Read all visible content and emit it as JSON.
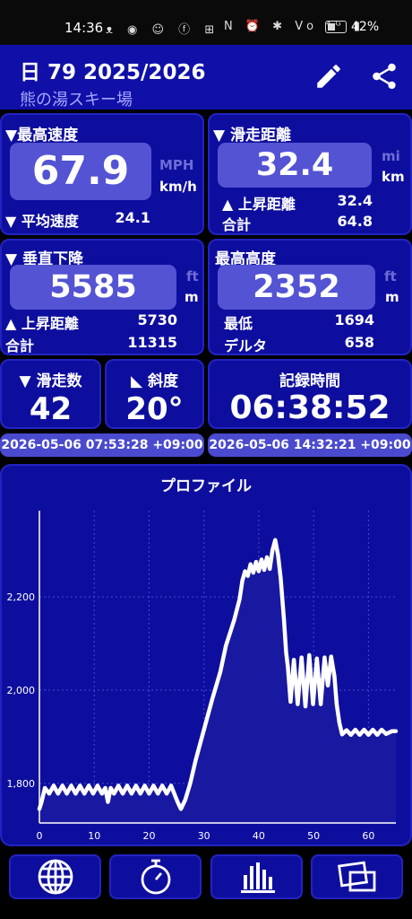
{
  "status_bar": {
    "time": "14:36",
    "left_icons": "ᴥ ◉ ☺ ⓕ ⊞",
    "right_icons": "N ⏰ ✱ Vo ⁴ᴳ ▮",
    "battery": "42%"
  },
  "header": {
    "title": "日 79 2025/2026",
    "subtitle": "熊の湯スキー場"
  },
  "max_speed": {
    "label": "▼最高速度",
    "value": "67.9",
    "unit_inactive": "MPH",
    "unit_active": "km/h",
    "avg_label": "▼ 平均速度",
    "avg_value": "24.1"
  },
  "run_distance": {
    "label": "▼ 滑走距離",
    "value": "32.4",
    "unit_inactive": "mi",
    "unit_active": "km",
    "up_label": "▲ 上昇距離",
    "up_value": "32.4",
    "total_label": "合計",
    "total_value": "64.8"
  },
  "vertical_descent": {
    "label": "▼ 垂直下降",
    "value": "5585",
    "unit_inactive": "ft",
    "unit_active": "m",
    "up_label": "▲ 上昇距離",
    "up_value": "5730",
    "total_label": "合計",
    "total_value": "11315"
  },
  "max_altitude": {
    "label": "最高高度",
    "value": "2352",
    "unit_inactive": "ft",
    "unit_active": "m",
    "min_label": "最低",
    "min_value": "1694",
    "delta_label": "デルタ",
    "delta_value": "658"
  },
  "runs": {
    "label": "▼ 滑走数",
    "value": "42"
  },
  "slope": {
    "label": "◣ 斜度",
    "value": "20°"
  },
  "recording": {
    "label": "記録時間",
    "value": "06:38:52"
  },
  "start_time": "2026-05-06 07:53:28 +09:00",
  "end_time": "2026-05-06 14:32:21 +09:00",
  "nav": [
    "globe-icon",
    "stopwatch-icon",
    "bar-chart-icon",
    "photos-icon"
  ],
  "chart_data": {
    "type": "area",
    "title": "プロファイル",
    "xlabel": "",
    "ylabel": "",
    "xlim": [
      0,
      65
    ],
    "ylim": [
      1715,
      2385
    ],
    "x_ticks": [
      0,
      10,
      20,
      30,
      40,
      50,
      60
    ],
    "y_ticks": [
      1800,
      2000,
      2200
    ],
    "y_tick_labels": [
      "1,800",
      "2,000",
      "2,200"
    ],
    "grid": true,
    "line_color": "#ffffff",
    "fill_color": "#1818a0",
    "points": [
      [
        0,
        1745
      ],
      [
        0.4,
        1760
      ],
      [
        1,
        1790
      ],
      [
        1.8,
        1778
      ],
      [
        2.6,
        1795
      ],
      [
        3.4,
        1778
      ],
      [
        4.2,
        1795
      ],
      [
        5,
        1778
      ],
      [
        5.8,
        1795
      ],
      [
        6.6,
        1778
      ],
      [
        7.4,
        1795
      ],
      [
        8.2,
        1778
      ],
      [
        9,
        1795
      ],
      [
        9.8,
        1778
      ],
      [
        10.6,
        1795
      ],
      [
        11.4,
        1778
      ],
      [
        12,
        1790
      ],
      [
        12.5,
        1760
      ],
      [
        13,
        1790
      ],
      [
        13.6,
        1778
      ],
      [
        14.4,
        1795
      ],
      [
        15.2,
        1778
      ],
      [
        16,
        1795
      ],
      [
        16.8,
        1778
      ],
      [
        17.6,
        1795
      ],
      [
        18.4,
        1778
      ],
      [
        19.2,
        1795
      ],
      [
        20,
        1778
      ],
      [
        20.8,
        1795
      ],
      [
        21.6,
        1778
      ],
      [
        22.4,
        1795
      ],
      [
        23.2,
        1778
      ],
      [
        24,
        1795
      ],
      [
        24.6,
        1778
      ],
      [
        25.2,
        1760
      ],
      [
        25.8,
        1745
      ],
      [
        26.6,
        1765
      ],
      [
        27.5,
        1800
      ],
      [
        28.5,
        1850
      ],
      [
        30,
        1915
      ],
      [
        31.5,
        1980
      ],
      [
        33,
        2040
      ],
      [
        34,
        2095
      ],
      [
        35.5,
        2150
      ],
      [
        36.5,
        2195
      ],
      [
        37,
        2235
      ],
      [
        37.5,
        2255
      ],
      [
        38,
        2245
      ],
      [
        38.5,
        2270
      ],
      [
        39,
        2252
      ],
      [
        39.5,
        2275
      ],
      [
        40,
        2255
      ],
      [
        40.5,
        2280
      ],
      [
        41,
        2258
      ],
      [
        41.5,
        2285
      ],
      [
        42,
        2260
      ],
      [
        42.5,
        2300
      ],
      [
        43,
        2322
      ],
      [
        43.5,
        2290
      ],
      [
        44,
        2240
      ],
      [
        44.6,
        2150
      ],
      [
        45,
        2080
      ],
      [
        45.3,
        2050
      ],
      [
        45.8,
        1975
      ],
      [
        46.4,
        2065
      ],
      [
        47.1,
        1970
      ],
      [
        47.8,
        2070
      ],
      [
        48.5,
        1965
      ],
      [
        49.2,
        2075
      ],
      [
        49.9,
        1970
      ],
      [
        50.6,
        2068
      ],
      [
        51.3,
        1970
      ],
      [
        52,
        2070
      ],
      [
        52.6,
        2010
      ],
      [
        53.2,
        2072
      ],
      [
        53.8,
        2030
      ],
      [
        54.2,
        1970
      ],
      [
        54.7,
        1930
      ],
      [
        55.2,
        1905
      ],
      [
        56,
        1914
      ],
      [
        56.8,
        1904
      ],
      [
        57.6,
        1915
      ],
      [
        58.4,
        1904
      ],
      [
        59.2,
        1915
      ],
      [
        60,
        1904
      ],
      [
        60.8,
        1915
      ],
      [
        61.6,
        1904
      ],
      [
        62.4,
        1915
      ],
      [
        63.2,
        1906
      ],
      [
        64.3,
        1912
      ],
      [
        65,
        1912
      ]
    ]
  }
}
